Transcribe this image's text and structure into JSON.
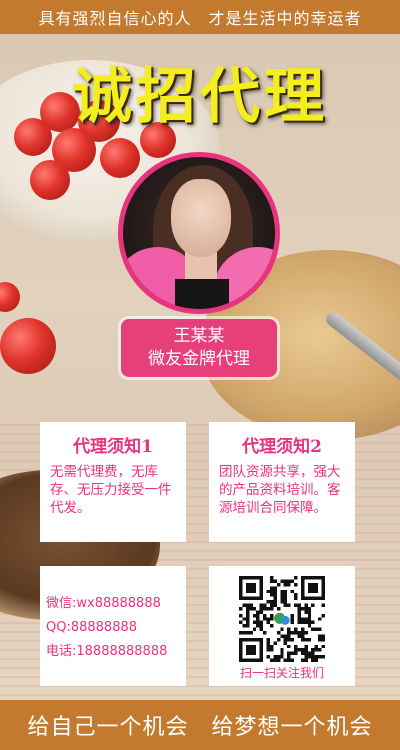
{
  "top_banner": "具有强烈自信心的人　才是生活中的幸运者",
  "headline": "诚招代理",
  "profile": {
    "name": "王某某",
    "title": "微友金牌代理"
  },
  "cards": [
    {
      "title": "代理须知1",
      "body": "无需代理费，无库存、无压力接受一件代发。"
    },
    {
      "title": "代理须知2",
      "body": "团队资源共享，强大的产品资料培训。客源培训合同保障。"
    }
  ],
  "contact": {
    "wechat": "微信:wx88888888",
    "qq": "QQ:88888888",
    "phone": "电话:18888888888"
  },
  "qr": {
    "label": "扫一扫关注我们",
    "icon": "qr-code-icon"
  },
  "bottom_banner": "给自己一个机会　给梦想一个机会",
  "colors": {
    "accent_pink": "#e8337e",
    "bar_orange": "#c47a2e",
    "headline_yellow": "#f4ee1e"
  }
}
